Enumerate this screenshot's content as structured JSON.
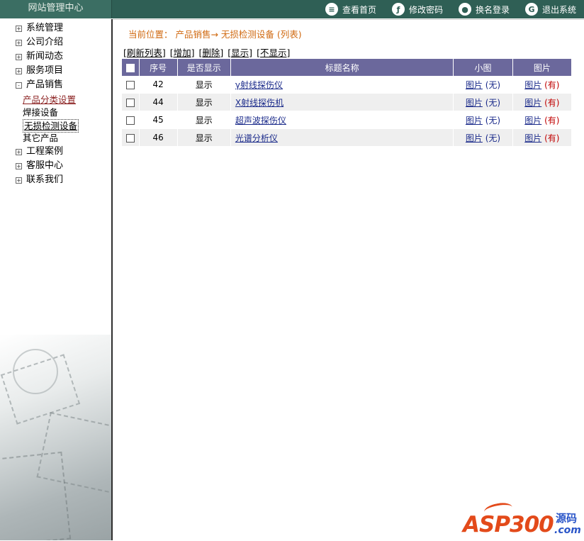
{
  "header": {
    "brand": "网站管理中心",
    "links": [
      {
        "label": "查看首页",
        "icon": "document-icon"
      },
      {
        "label": "修改密码",
        "icon": "key-icon"
      },
      {
        "label": "换名登录",
        "icon": "user-icon"
      },
      {
        "label": "退出系统",
        "icon": "exit-icon"
      }
    ]
  },
  "sidebar": {
    "items": [
      {
        "label": "系统管理",
        "box": "+"
      },
      {
        "label": "公司介绍",
        "box": "+"
      },
      {
        "label": "新闻动态",
        "box": "+"
      },
      {
        "label": "服务项目",
        "box": "+"
      },
      {
        "label": "产品销售",
        "box": "-"
      },
      {
        "label": "工程案例",
        "box": "+"
      },
      {
        "label": "客服中心",
        "box": "+"
      },
      {
        "label": "联系我们",
        "box": "+"
      }
    ],
    "subitems": [
      "产品分类设置",
      "焊接设备",
      "无损检测设备",
      "其它产品"
    ]
  },
  "main": {
    "breadcrumb": "当前位置： 产品销售→ 无损检测设备 (列表)",
    "actions": [
      "[刷新列表]",
      "[增加]",
      "[删除]",
      "[显示]",
      "[不显示]"
    ],
    "columns": [
      "",
      "序号",
      "是否显示",
      "标题名称",
      "小图",
      "图片"
    ],
    "rows": [
      {
        "id": "42",
        "show": "显示",
        "title": "γ射线探伤仪",
        "thumb_link": "图片",
        "thumb_status": "(无)",
        "pic_link": "图片",
        "pic_status": "(有)"
      },
      {
        "id": "44",
        "show": "显示",
        "title": "X射线探伤机",
        "thumb_link": "图片",
        "thumb_status": "(无)",
        "pic_link": "图片",
        "pic_status": "(有)"
      },
      {
        "id": "45",
        "show": "显示",
        "title": "超声波探伤仪",
        "thumb_link": "图片",
        "thumb_status": "(无)",
        "pic_link": "图片",
        "pic_status": "(有)"
      },
      {
        "id": "46",
        "show": "显示",
        "title": "光谱分析仪",
        "thumb_link": "图片",
        "thumb_status": "(无)",
        "pic_link": "图片",
        "pic_status": "(有)"
      }
    ]
  },
  "logo": {
    "text": "ASP300",
    "yuan": "源码",
    "com": ".com"
  }
}
